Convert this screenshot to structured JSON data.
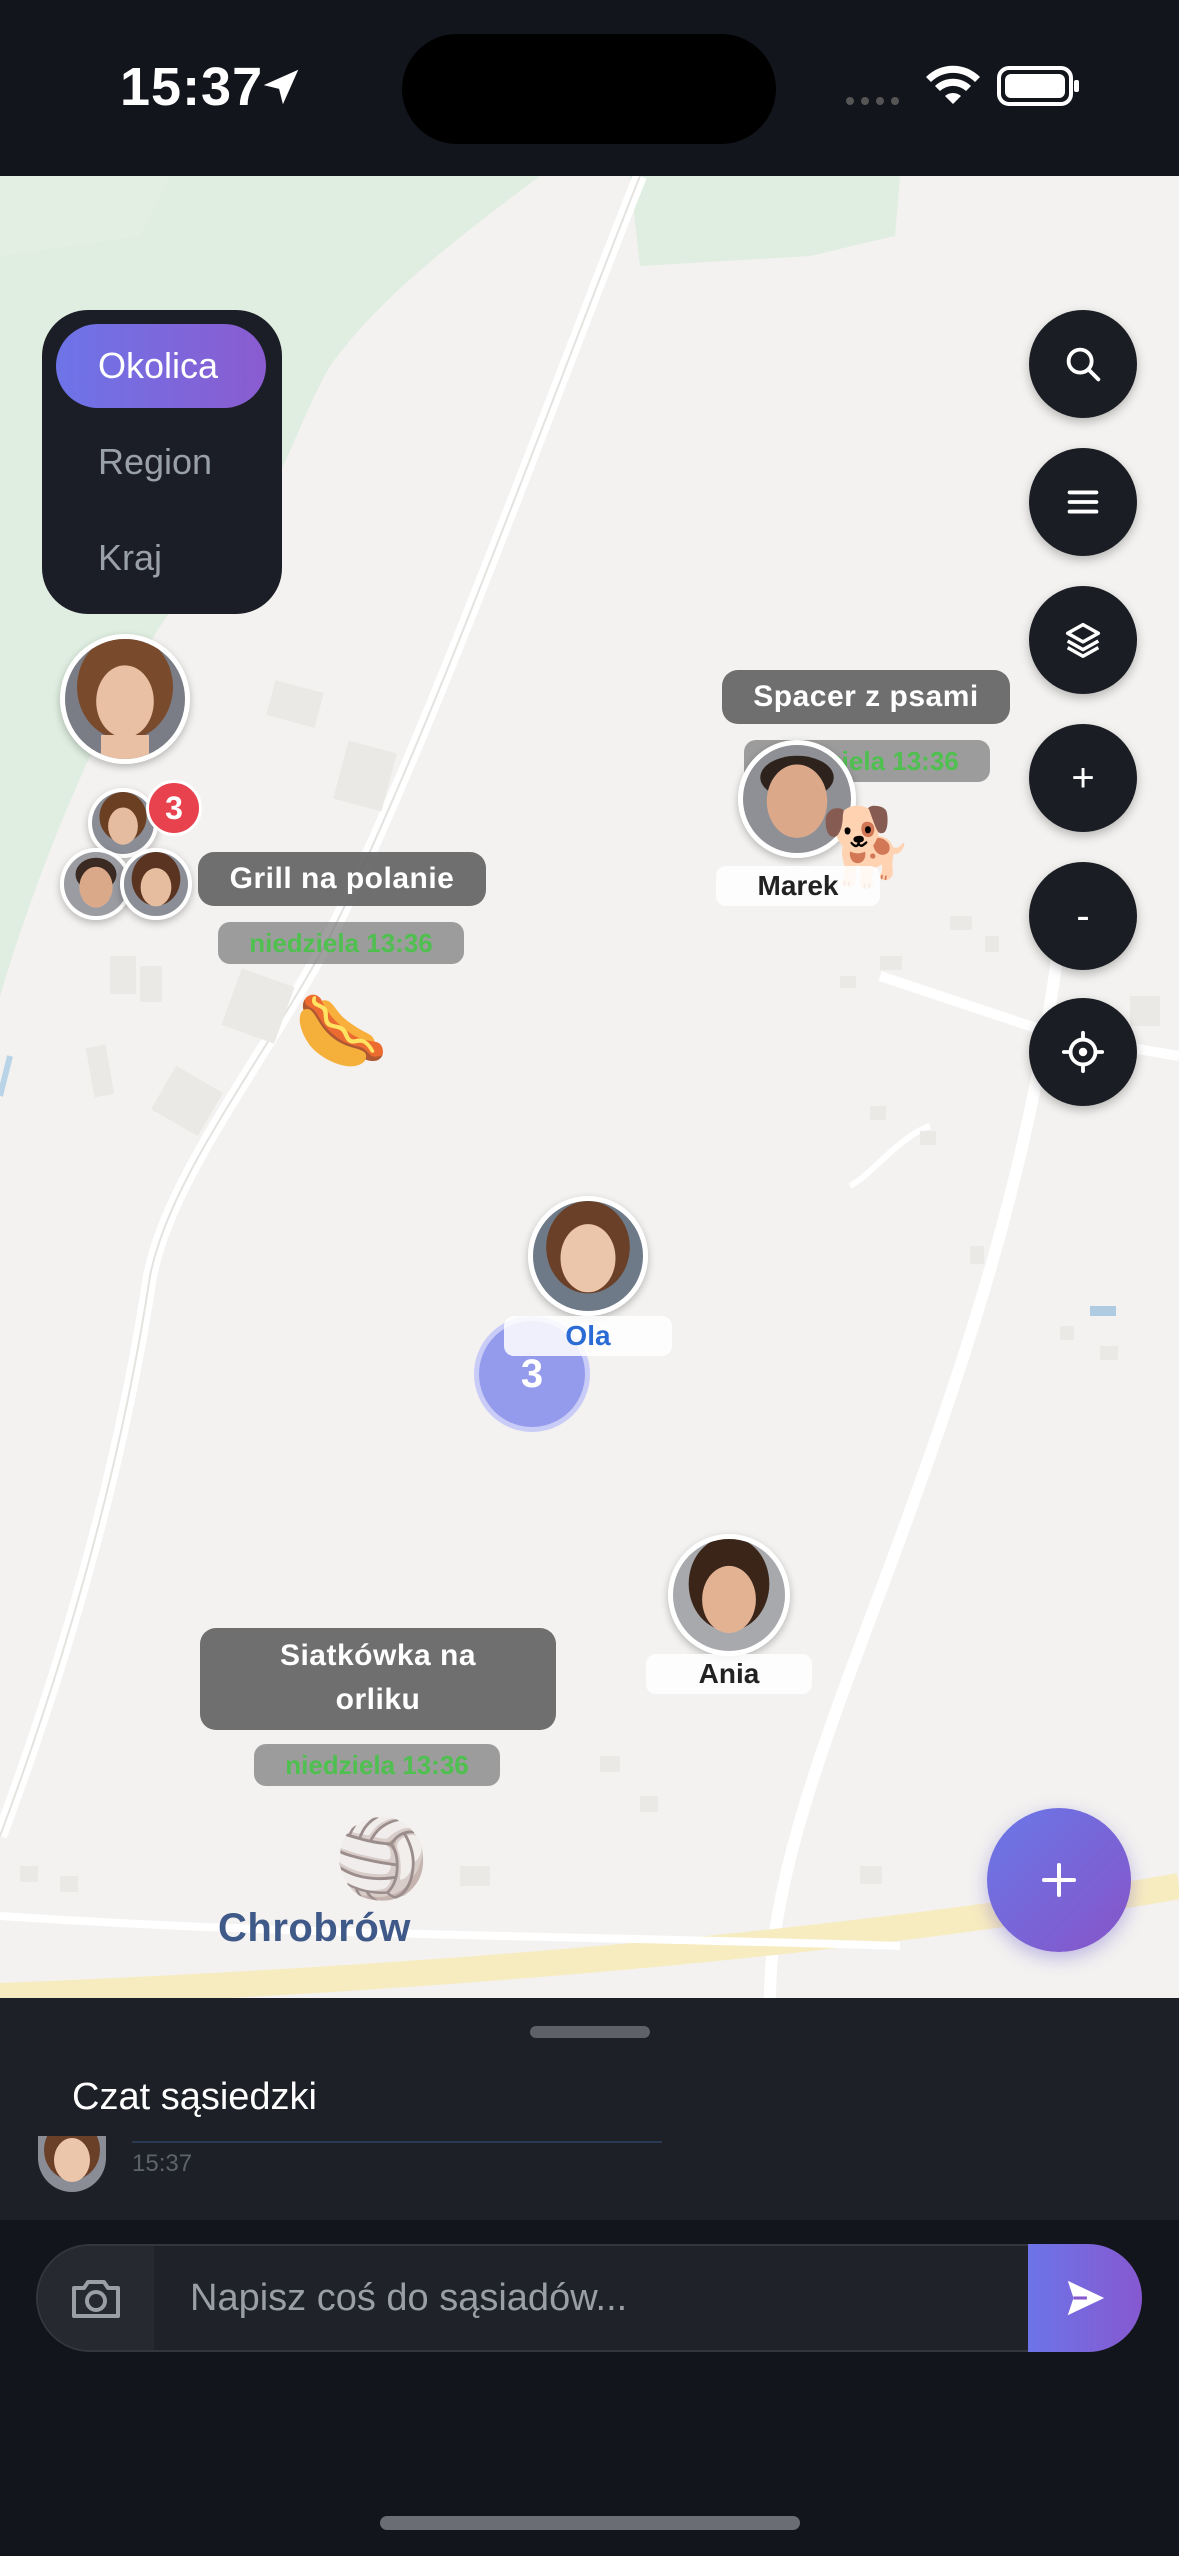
{
  "status_bar": {
    "time": "15:37"
  },
  "map": {
    "scope_tabs": [
      {
        "label": "Okolica",
        "active": true
      },
      {
        "label": "Region",
        "active": false
      },
      {
        "label": "Kraj",
        "active": false
      }
    ],
    "controls": {
      "zoom_in": "+",
      "zoom_out": "-"
    },
    "events": [
      {
        "title": "Spacer z psami",
        "time": "niedziela 13:36",
        "emoji": "🐕"
      },
      {
        "title": "Grill na polanie",
        "time": "niedziela 13:36",
        "emoji": "🌭"
      },
      {
        "title": "Siatkówka na orliku",
        "time": "niedziela 13:36",
        "emoji": "🏐"
      }
    ],
    "people": [
      {
        "name": "Marek"
      },
      {
        "name": "Ola"
      },
      {
        "name": "Ania"
      }
    ],
    "group_badge": "3",
    "cluster_count": "3",
    "place_label": "Chrobrów",
    "colors": {
      "accent": "#6d74e8",
      "event_time": "#4fc04f",
      "badge": "#e8424e"
    }
  },
  "chat": {
    "title": "Czat sąsiedzki",
    "last_message_time": "15:37",
    "input_placeholder": "Napisz coś do sąsiadów..."
  }
}
